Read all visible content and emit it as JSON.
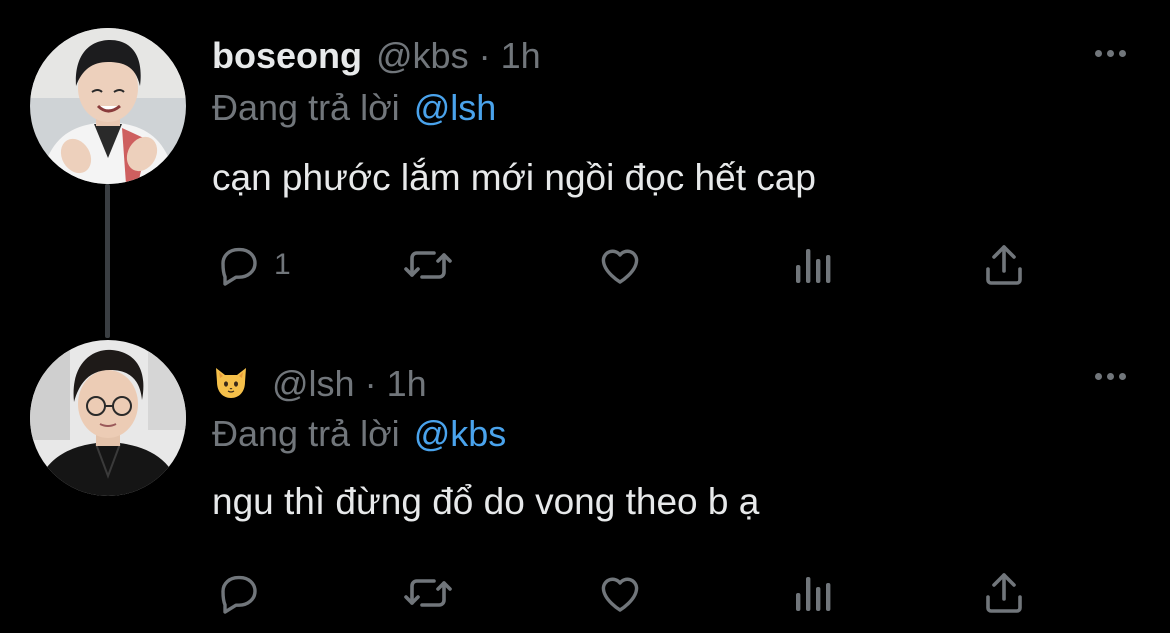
{
  "tweets": [
    {
      "display_name": "boseong",
      "handle": "@kbs",
      "time": "1h",
      "replying_label": "Đang trả lời",
      "replying_to": "@lsh",
      "text": "cạn phước lắm mới ngồi đọc hết cap",
      "reply_count": "1",
      "avatar": "avatar-photo"
    },
    {
      "display_name_emoji": "cat-face-emoji",
      "handle": "@lsh",
      "time": "1h",
      "replying_label": "Đang trả lời",
      "replying_to": "@kbs",
      "text": "ngu thì đừng đổ do vong theo b ạ",
      "reply_count": "",
      "avatar": "avatar-photo"
    }
  ],
  "separator": "·",
  "icons": [
    "more-icon",
    "reply-icon",
    "retweet-icon",
    "like-icon",
    "views-icon",
    "share-icon"
  ],
  "colors": {
    "background": "#000000",
    "text": "#e7e9ea",
    "muted": "#71767b",
    "mention": "#4aa3ec",
    "thread_line": "#3a3e42"
  }
}
